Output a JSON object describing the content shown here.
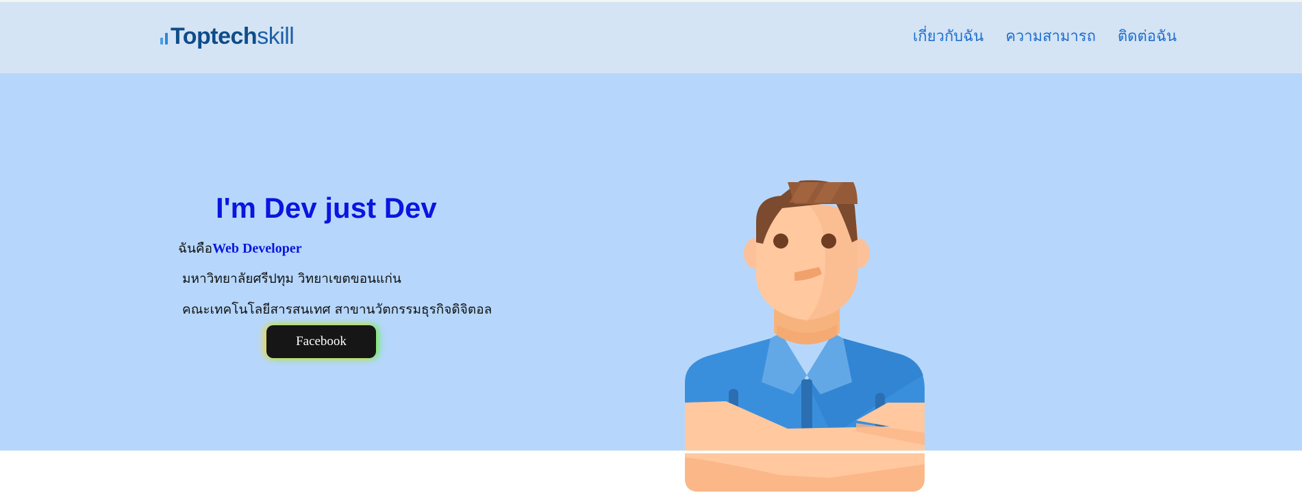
{
  "header": {
    "logo": {
      "bold": "Toptech",
      "light": "skill"
    },
    "nav": [
      {
        "label": "เกี่ยวกับฉัน"
      },
      {
        "label": "ความสามารถ"
      },
      {
        "label": "ติดต่อฉัน"
      }
    ]
  },
  "hero": {
    "title": "I'm Dev just Dev",
    "intro_prefix": "ฉันคือ",
    "intro_role": "Web Developer",
    "university": "มหาวิทยาลัยศรีปทุม วิทยาเขตขอนแก่น",
    "faculty": "คณะเทคโนโลยีสารสนเทศ สาขานวัตกรรมธุรกิจดิจิตอล",
    "button_label": "Facebook",
    "illustration_icon": "developer-avatar-icon"
  },
  "colors": {
    "navbar_bg": "#d4e4f4",
    "hero_bg": "#b6d7fb",
    "title_blue": "#0a15e0",
    "nav_blue": "#1f6fcf",
    "button_bg": "#161616"
  }
}
